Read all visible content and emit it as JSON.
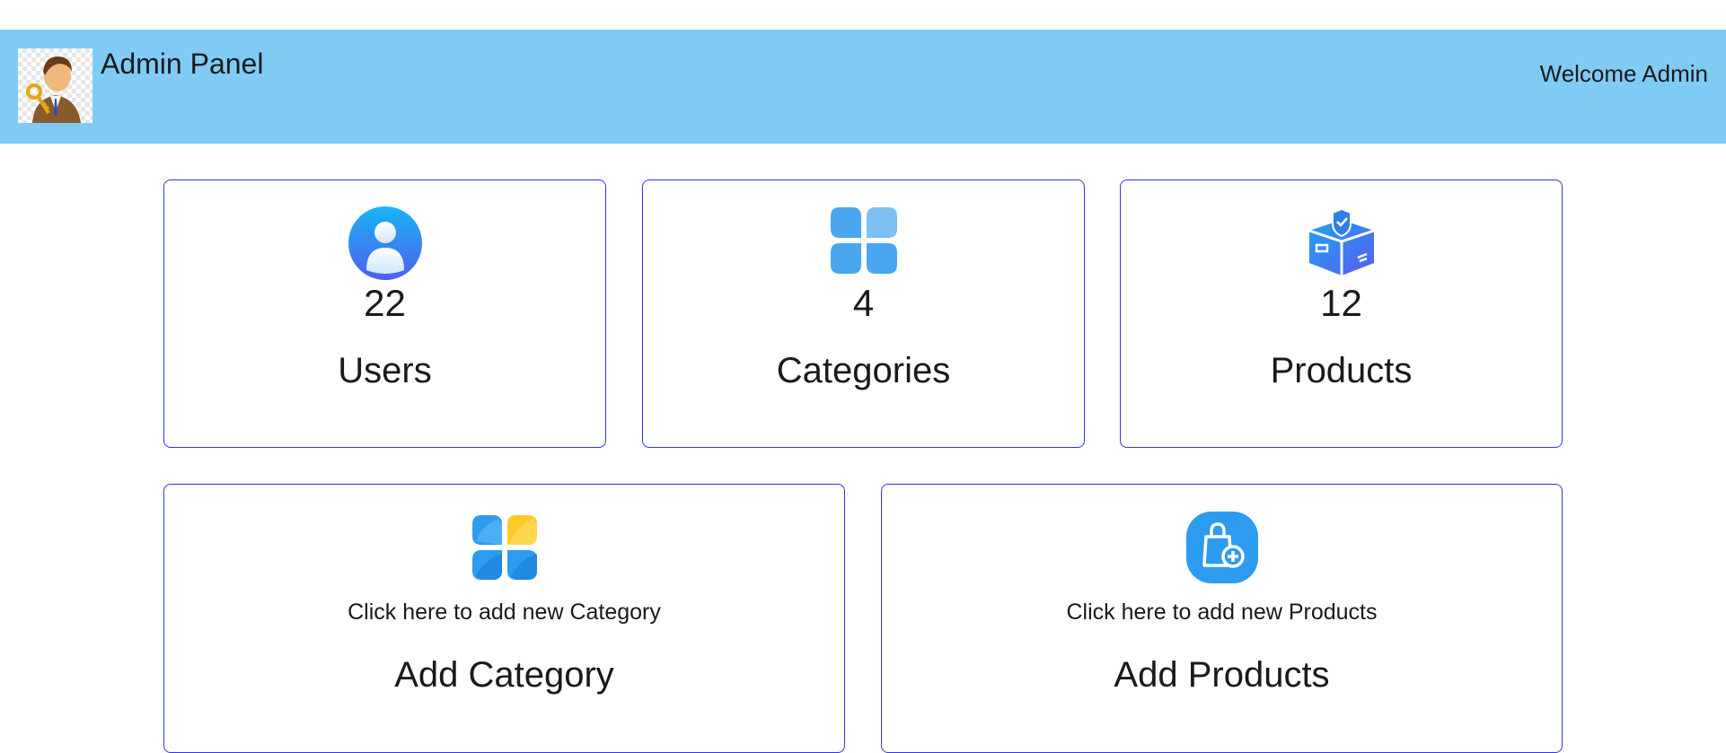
{
  "header": {
    "brand": "Admin Panel",
    "welcome": "Welcome Admin",
    "background_color": "#7fcbf6"
  },
  "stats": [
    {
      "icon": "user-circle-icon",
      "count": "22",
      "label": "Users"
    },
    {
      "icon": "category-grid-icon",
      "count": "4",
      "label": "Categories"
    },
    {
      "icon": "product-box-icon",
      "count": "12",
      "label": "Products"
    }
  ],
  "actions": [
    {
      "icon": "add-category-icon",
      "hint": "Click here to add new Category",
      "label": "Add Category"
    },
    {
      "icon": "add-product-bag-icon",
      "hint": "Click here to add new Products",
      "label": "Add Products"
    }
  ],
  "colors": {
    "card_border": "#3333ee",
    "icon_blue": "#2d9cf0",
    "icon_yellow": "#ffc928"
  }
}
